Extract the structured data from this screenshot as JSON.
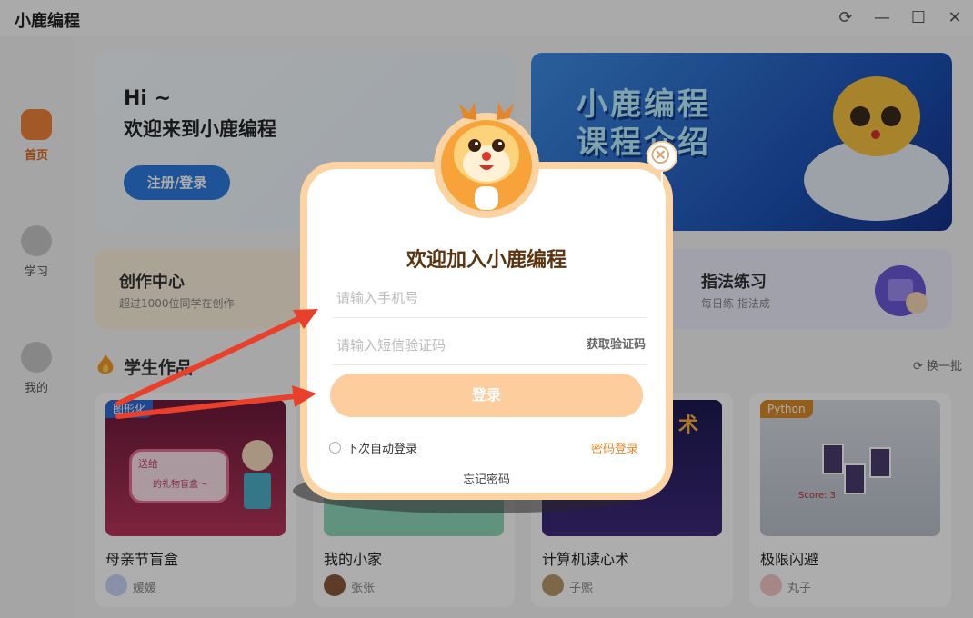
{
  "app": {
    "title": "小鹿编程"
  },
  "window_controls": {
    "refresh": "⟳",
    "minimize": "—",
    "maximize": "☐",
    "close": "✕"
  },
  "sidebar": {
    "items": [
      {
        "label": "首页",
        "active": true
      },
      {
        "label": "学习"
      },
      {
        "label": "我的"
      }
    ]
  },
  "hero": {
    "hi": "Hi ~",
    "welcome": "欢迎来到小鹿编程",
    "button": "注册/登录"
  },
  "banner": {
    "line1": "小鹿编程",
    "line2": "课程介绍"
  },
  "cards": [
    {
      "title": "创作中心",
      "subtitle": "超过1000位同学在创作"
    },
    {
      "title": "指法练习",
      "subtitle": "每日练 指法成"
    }
  ],
  "works_section": {
    "title": "学生作品",
    "refresh": "换一批"
  },
  "works": [
    {
      "tag": "图形化",
      "title": "母亲节盲盒",
      "author": "媛媛",
      "thumb_texts": [
        "送给",
        "的礼物盲盒～"
      ]
    },
    {
      "tag": "",
      "title": "我的小家",
      "author": "张张"
    },
    {
      "tag": "",
      "title": "计算机读心术",
      "author": "子熙",
      "thumb_texts": [
        "术"
      ]
    },
    {
      "tag": "Python",
      "title": "极限闪避",
      "author": "丸子",
      "thumb_texts": [
        "Score: 3"
      ]
    }
  ],
  "login_modal": {
    "title": "欢迎加入小鹿编程",
    "phone_placeholder": "请输入手机号",
    "code_placeholder": "请输入短信验证码",
    "get_code": "获取验证码",
    "login_button": "登录",
    "remember": "下次自动登录",
    "password_login": "密码登录",
    "forgot": "忘记密码"
  },
  "colors": {
    "accent_orange": "#e8892c",
    "login_button": "#fecd9d",
    "modal_border": "#fcd4a3",
    "primary_blue": "#2d7be0",
    "arrow_red": "#e8402a"
  }
}
